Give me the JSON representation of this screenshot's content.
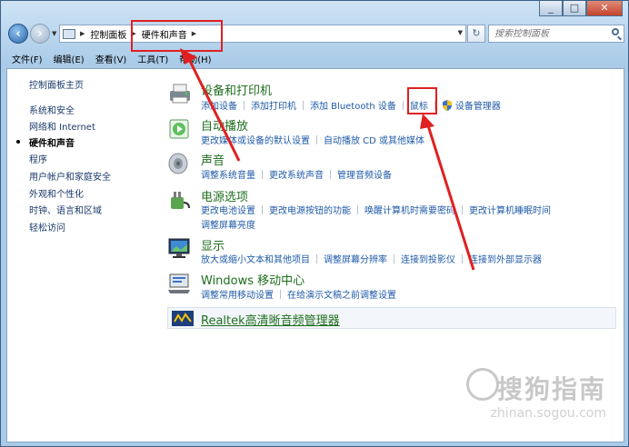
{
  "caption": {
    "minimize": "_",
    "maximize": "□",
    "close": "✕"
  },
  "address": {
    "crumbs": [
      "控制面板",
      "硬件和声音"
    ]
  },
  "search": {
    "placeholder": "搜索控制面板"
  },
  "menu": [
    "文件(F)",
    "编辑(E)",
    "查看(V)",
    "工具(T)",
    "帮助(H)"
  ],
  "sidebar": {
    "items": [
      {
        "label": "控制面板主页",
        "active": false
      },
      {
        "label": "系统和安全",
        "active": false
      },
      {
        "label": "网络和 Internet",
        "active": false
      },
      {
        "label": "硬件和声音",
        "active": true
      },
      {
        "label": "程序",
        "active": false
      },
      {
        "label": "用户帐户和家庭安全",
        "active": false
      },
      {
        "label": "外观和个性化",
        "active": false
      },
      {
        "label": "时钟、语言和区域",
        "active": false
      },
      {
        "label": "轻松访问",
        "active": false
      }
    ]
  },
  "categories": [
    {
      "title": "设备和打印机",
      "icon": "printer-icon",
      "rows": [
        [
          "添加设备",
          "添加打印机",
          "添加 Bluetooth 设备",
          "鼠标",
          "设备管理器"
        ]
      ]
    },
    {
      "title": "自动播放",
      "icon": "autoplay-icon",
      "rows": [
        [
          "更改媒体或设备的默认设置",
          "自动播放 CD 或其他媒体"
        ]
      ]
    },
    {
      "title": "声音",
      "icon": "speaker-icon",
      "rows": [
        [
          "调整系统音量",
          "更改系统声音",
          "管理音频设备"
        ]
      ]
    },
    {
      "title": "电源选项",
      "icon": "power-icon",
      "rows": [
        [
          "更改电池设置",
          "更改电源按钮的功能",
          "唤醒计算机时需要密码",
          "更改计算机睡眠时间"
        ],
        [
          "调整屏幕亮度"
        ]
      ]
    },
    {
      "title": "显示",
      "icon": "display-icon",
      "rows": [
        [
          "放大或缩小文本和其他项目",
          "调整屏幕分辨率",
          "连接到投影仪",
          "连接到外部显示器"
        ]
      ]
    },
    {
      "title": "Windows 移动中心",
      "icon": "mobility-center-icon",
      "rows": [
        [
          "调整常用移动设置",
          "在给演示文稿之前调整设置"
        ]
      ]
    }
  ],
  "realtek": {
    "title": "Realtek高清晰音频管理器",
    "icon": "realtek-icon"
  },
  "watermark": {
    "main": "搜狗指南",
    "sub": "zhinan.sogou.com"
  },
  "colors": {
    "category_title": "#1e6e1e",
    "link": "#1f5aa8",
    "annotation": "#e02020"
  }
}
